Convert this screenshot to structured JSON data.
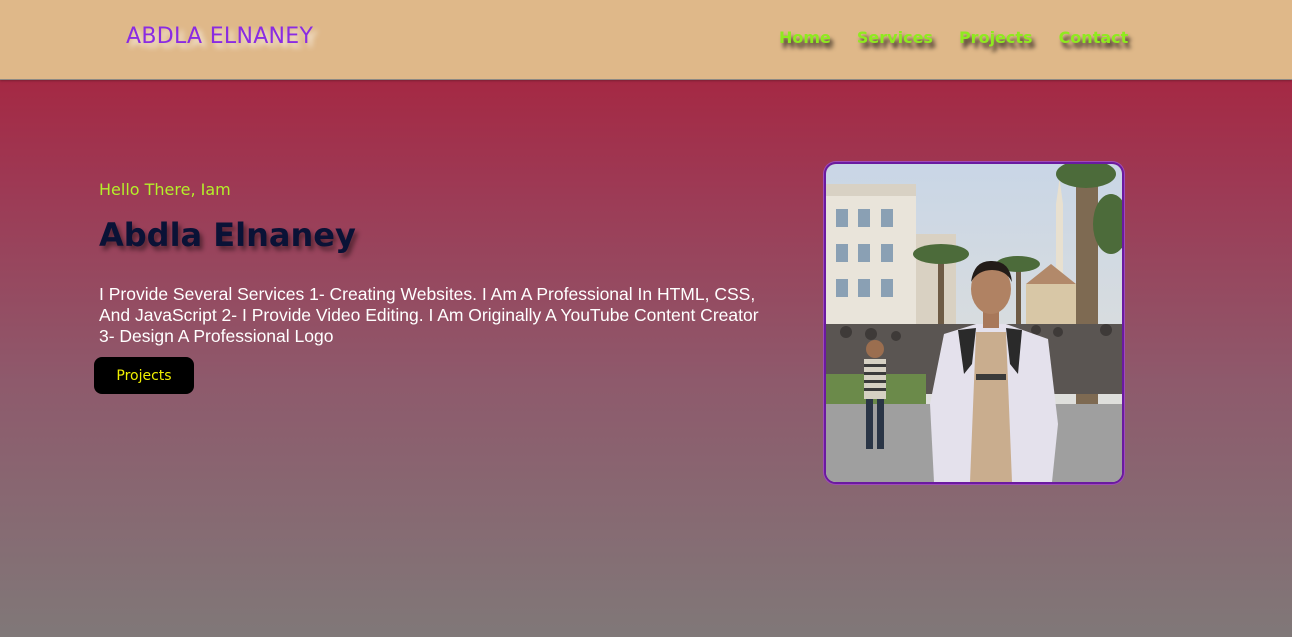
{
  "header": {
    "logo": "ABDLA ELNANEY",
    "nav": [
      "Home",
      "Services",
      "Projects",
      "Contact"
    ]
  },
  "hero": {
    "greeting": "Hello There, Iam",
    "name": "Abdla Elnaney",
    "description": "I Provide Several Services 1- Creating Websites. I Am A Professional In HTML, CSS, And JavaScript 2- I Provide Video Editing. I Am Originally A YouTube Content Creator 3- Design A Professional Logo",
    "button_label": "Projects"
  },
  "colors": {
    "header_bg": "#dfb889",
    "logo": "#8a2be2",
    "nav_link": "#8fea1f",
    "greeting": "#b4f02a",
    "name": "#0a1236",
    "button_bg": "#000000",
    "button_text": "#f0f000",
    "photo_border": "#6a1aa0"
  },
  "photo": {
    "alt_icon": "profile-photo"
  }
}
